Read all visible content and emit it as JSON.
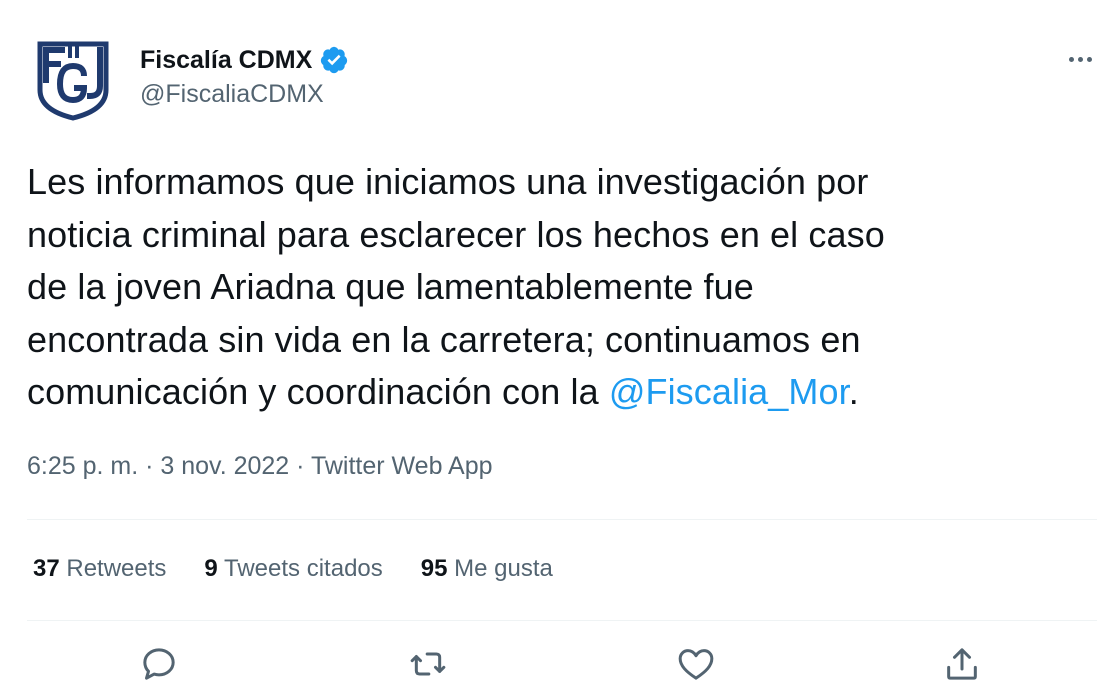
{
  "user": {
    "display_name": "Fiscalía CDMX",
    "handle": "@FiscaliaCDMX",
    "verified_icon": "verified-badge-icon",
    "avatar_icon": "fgj-logo-icon",
    "avatar_text": "FGJ"
  },
  "tweet": {
    "text_before_mention": "Les informamos que iniciamos una investigación por\nnoticia criminal para esclarecer los hechos en el caso\nde la joven Ariadna que lamentablemente fue\nencontrada sin vida en la carretera; continuamos en\ncomunicación y coordinación con la ",
    "mention": "@Fiscalia_Mor",
    "text_after_mention": "."
  },
  "meta": {
    "time": "6:25 p. m.",
    "separator": " · ",
    "date": "3 nov. 2022",
    "source": "Twitter Web App"
  },
  "stats": {
    "retweets_count": "37",
    "retweets_label": "Retweets",
    "quotes_count": "9",
    "quotes_label": "Tweets citados",
    "likes_count": "95",
    "likes_label": "Me gusta"
  },
  "actions": {
    "reply_icon": "reply-icon",
    "retweet_icon": "retweet-icon",
    "like_icon": "heart-icon",
    "share_icon": "share-icon"
  },
  "colors": {
    "text": "#0f1419",
    "secondary": "#536471",
    "link": "#1d9bf0",
    "logo": "#1f3a6e",
    "divider": "#eff3f4"
  }
}
